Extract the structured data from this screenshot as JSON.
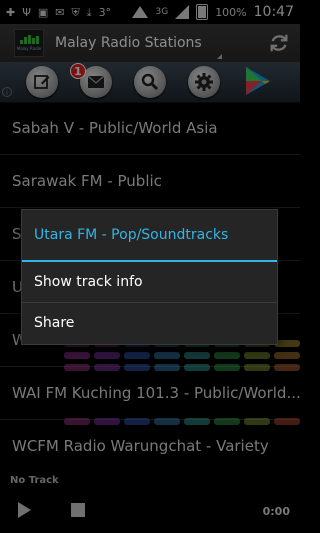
{
  "status_bar": {
    "notification_count": "3°",
    "network": "3G",
    "battery_percent": "100%",
    "time": "10:47"
  },
  "action_bar": {
    "title": "Malay Radio Stations",
    "logo_text": "Malay Radio"
  },
  "toolbar": {
    "badge_count": "1",
    "icons": [
      "edit-icon",
      "mail-icon",
      "search-icon",
      "settings-icon",
      "play-store-icon"
    ]
  },
  "stations": [
    {
      "name": "Sabah V - Public/World Asia"
    },
    {
      "name": "Sarawak FM - Public"
    },
    {
      "name": "S"
    },
    {
      "name": "U"
    },
    {
      "name": "W"
    },
    {
      "name": "WAI FM Kuching 101.3 - Public/World..."
    },
    {
      "name": "WCFM Radio Warungchat - Variety"
    }
  ],
  "player": {
    "track": "No Track",
    "time": "0:00"
  },
  "dialog": {
    "title": "Utara FM - Pop/Soundtracks",
    "options": [
      "Show track info",
      "Share"
    ]
  },
  "colors": {
    "accent": "#33b5e5",
    "badge": "#dd2222",
    "background": "#000000"
  }
}
